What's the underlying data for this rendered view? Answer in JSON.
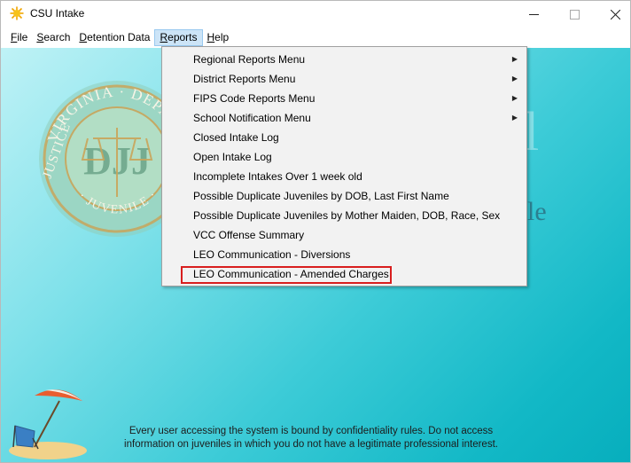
{
  "window": {
    "title": "CSU Intake",
    "icon": "sun-icon",
    "controls": {
      "minimize": "–",
      "maximize": "☐",
      "close": "✕"
    }
  },
  "menubar": {
    "items": [
      {
        "label": "File",
        "accel": "F",
        "rest": "ile"
      },
      {
        "label": "Search",
        "accel": "S",
        "rest": "earch"
      },
      {
        "label": "Detention Data",
        "accel": "D",
        "rest": "etention Data"
      },
      {
        "label": "Reports",
        "accel": "R",
        "rest": "eports",
        "open": true
      },
      {
        "label": "Help",
        "accel": "H",
        "rest": "elp"
      }
    ]
  },
  "reports_menu": {
    "items": [
      {
        "label": "Regional Reports Menu",
        "submenu": true
      },
      {
        "label": "District Reports Menu",
        "submenu": true
      },
      {
        "label": "FIPS Code Reports Menu",
        "submenu": true
      },
      {
        "label": "School Notification Menu",
        "submenu": true
      },
      {
        "label": "Closed Intake Log",
        "submenu": false
      },
      {
        "label": "Open Intake Log",
        "submenu": false
      },
      {
        "label": "Incomplete Intakes Over 1 week old",
        "submenu": false
      },
      {
        "label": "Possible Duplicate Juveniles by DOB, Last First Name",
        "submenu": false
      },
      {
        "label": "Possible Duplicate Juveniles by Mother Maiden, DOB, Race, Sex",
        "submenu": false
      },
      {
        "label": "VCC Offense Summary",
        "submenu": false
      },
      {
        "label": "LEO Communication - Diversions",
        "submenu": false
      },
      {
        "label": "LEO Communication - Amended Charges",
        "submenu": false,
        "highlighted": true
      }
    ],
    "submenu_arrow": "▶"
  },
  "client": {
    "seal_text": {
      "top": "VIRGINIA · DEP",
      "left": "JUSTICE",
      "bottom": "JUVENILE",
      "monogram": "DJJ"
    },
    "ghost_title": "l",
    "ghost_subtitle": "le",
    "notice": {
      "line1": "Every user accessing the system is bound by confidentiality rules. Do not access",
      "line2": "information on juveniles in which you do not have a legitimate professional interest."
    }
  },
  "colors": {
    "menu_open_bg": "#cce4f7",
    "highlight_border": "#d81e1e",
    "teal": "#12b8c6"
  }
}
